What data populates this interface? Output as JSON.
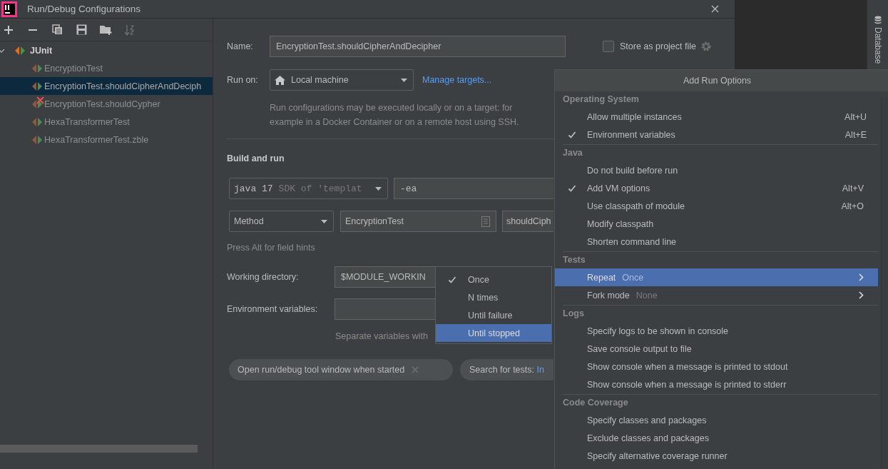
{
  "window": {
    "title": "Run/Debug Configurations"
  },
  "toolbar": [
    {
      "kind": "add",
      "disabled": false
    },
    {
      "kind": "remove",
      "disabled": false
    },
    {
      "kind": "copy",
      "disabled": false
    },
    {
      "kind": "save",
      "disabled": false
    },
    {
      "kind": "folder",
      "disabled": false
    },
    {
      "kind": "sort",
      "disabled": true
    }
  ],
  "tree": [
    {
      "label": "JUnit",
      "expanded": true,
      "children": [
        {
          "label": "EncryptionTest",
          "selected": false,
          "error": false
        },
        {
          "label": "EncryptionTest.shouldCipherAndDeciph",
          "selected": true,
          "error": false
        },
        {
          "label": "EncryptionTest.shouldCypher",
          "selected": false,
          "error": true
        },
        {
          "label": "HexaTransformerTest",
          "selected": false,
          "error": false
        },
        {
          "label": "HexaTransformerTest.zble",
          "selected": false,
          "error": false
        }
      ]
    }
  ],
  "form": {
    "name": {
      "label": "Name:",
      "value": "EncryptionTest.shouldCipherAndDecipher"
    },
    "store_as_project_file": {
      "label": "Store as project file",
      "checked": false
    },
    "run_on": {
      "label": "Run on:",
      "value": "Local machine",
      "link": "Manage targets...",
      "help": "Run configurations may be executed locally or on a target: for example in a Docker Container or on a remote host using SSH."
    },
    "build_and_run": {
      "title": "Build and run",
      "jre": {
        "value": "java 17",
        "hint": "SDK of 'templat"
      },
      "vm_options": "-ea",
      "test_kind": "Method",
      "class": "EncryptionTest",
      "method": "shouldCiph",
      "hint": "Press Alt for field hints"
    },
    "working_directory": {
      "label": "Working directory:",
      "value": "$MODULE_WORKIN"
    },
    "environment_variables": {
      "label": "Environment variables:",
      "help": "Separate variables with"
    },
    "chips": [
      {
        "label": "Open run/debug tool window when started",
        "closable": true
      },
      {
        "label": "Search for tests:",
        "link": "In",
        "closable": false
      }
    ]
  },
  "side_tab": {
    "label": "Database"
  },
  "run_options": {
    "title": "Add Run Options",
    "groups": [
      {
        "title": "Operating System",
        "items": [
          {
            "label": "Allow multiple instances",
            "checked": false,
            "selected": false,
            "shortcut": "Alt+U"
          },
          {
            "label": "Environment variables",
            "checked": true,
            "selected": false,
            "shortcut": "Alt+E"
          }
        ]
      },
      {
        "title": "Java",
        "items": [
          {
            "label": "Do not build before run",
            "checked": false,
            "selected": false
          },
          {
            "label": "Add VM options",
            "checked": true,
            "selected": false,
            "shortcut": "Alt+V"
          },
          {
            "label": "Use classpath of module",
            "checked": false,
            "selected": false,
            "shortcut": "Alt+O"
          },
          {
            "label": "Modify classpath",
            "checked": false,
            "selected": false
          },
          {
            "label": "Shorten command line",
            "checked": false,
            "selected": false
          }
        ]
      },
      {
        "title": "Tests",
        "items": [
          {
            "label": "Repeat",
            "value": "Once",
            "submenu": true,
            "checked": false,
            "selected": true
          },
          {
            "label": "Fork mode",
            "value": "None",
            "submenu": true,
            "checked": false,
            "selected": false
          }
        ]
      },
      {
        "title": "Logs",
        "items": [
          {
            "label": "Specify logs to be shown in console",
            "checked": false,
            "selected": false
          },
          {
            "label": "Save console output to file",
            "checked": false,
            "selected": false
          },
          {
            "label": "Show console when a message is printed to stdout",
            "checked": false,
            "selected": false
          },
          {
            "label": "Show console when a message is printed to stderr",
            "checked": false,
            "selected": false
          }
        ]
      },
      {
        "title": "Code Coverage",
        "items": [
          {
            "label": "Specify classes and packages",
            "checked": false,
            "selected": false
          },
          {
            "label": "Exclude classes and packages",
            "checked": false,
            "selected": false
          },
          {
            "label": "Specify alternative coverage runner",
            "checked": false,
            "selected": false
          }
        ]
      }
    ]
  },
  "repeat_menu": [
    {
      "label": "Once",
      "checked": true,
      "selected": false
    },
    {
      "label": "N times",
      "checked": false,
      "selected": false
    },
    {
      "label": "Until failure",
      "checked": false,
      "selected": false
    },
    {
      "label": "Until stopped",
      "checked": false,
      "selected": true
    }
  ]
}
